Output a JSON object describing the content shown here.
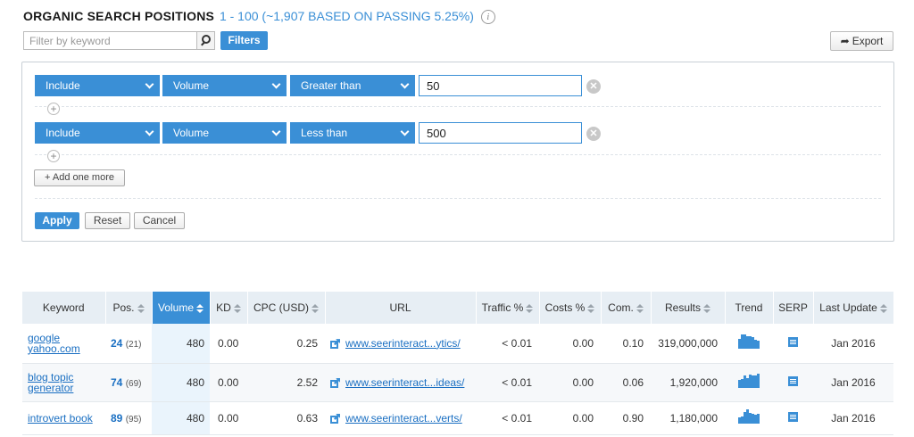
{
  "header": {
    "title": "ORGANIC SEARCH POSITIONS",
    "range": "1 - 100 (~1,907 BASED ON PASSING 5.25%)",
    "info_glyph": "i"
  },
  "toolbar": {
    "filter_placeholder": "Filter by keyword",
    "filters_label": "Filters",
    "export_label": "Export"
  },
  "filter_rules": [
    {
      "mode": "Include",
      "field": "Volume",
      "operator": "Greater than",
      "value": "50"
    },
    {
      "mode": "Include",
      "field": "Volume",
      "operator": "Less than",
      "value": "500"
    }
  ],
  "panel": {
    "add_more_label": "+ Add one more",
    "apply_label": "Apply",
    "reset_label": "Reset",
    "cancel_label": "Cancel"
  },
  "table": {
    "columns": [
      "Keyword",
      "Pos.",
      "Volume",
      "KD",
      "CPC (USD)",
      "URL",
      "Traffic %",
      "Costs %",
      "Com.",
      "Results",
      "Trend",
      "SERP",
      "Last Update"
    ],
    "active_sort": "Volume",
    "rows": [
      {
        "keyword_l1": "google",
        "keyword_l2": "yahoo.com",
        "pos": "24",
        "prev_pos": "(21)",
        "volume": "480",
        "kd": "0.00",
        "cpc": "0.25",
        "url": "www.seerinteract...ytics/",
        "traffic": "< 0.01",
        "costs": "0.00",
        "com": "0.10",
        "results": "319,000,000",
        "last_update": "Jan 2016",
        "trend": [
          0.7,
          1.0,
          1.0,
          0.9,
          0.85,
          0.8,
          0.6,
          0.55
        ]
      },
      {
        "keyword_l1": "blog topic",
        "keyword_l2": "generator",
        "pos": "74",
        "prev_pos": "(69)",
        "volume": "480",
        "kd": "0.00",
        "cpc": "2.52",
        "url": "www.seerinteract...ideas/",
        "traffic": "< 0.01",
        "costs": "0.00",
        "com": "0.06",
        "results": "1,920,000",
        "last_update": "Jan 2016",
        "trend": [
          0.55,
          0.6,
          0.85,
          0.7,
          0.95,
          0.9,
          0.9,
          1.0
        ]
      },
      {
        "keyword_l1": "introvert book",
        "keyword_l2": "",
        "pos": "89",
        "prev_pos": "(95)",
        "volume": "480",
        "kd": "0.00",
        "cpc": "0.63",
        "url": "www.seerinteract...verts/",
        "traffic": "< 0.01",
        "costs": "0.00",
        "com": "0.90",
        "results": "1,180,000",
        "last_update": "Jan 2016",
        "trend": [
          0.45,
          0.5,
          0.8,
          1.0,
          0.75,
          0.7,
          0.65,
          0.7
        ]
      }
    ]
  },
  "colors": {
    "accent": "#3a8fd6",
    "link": "#1a6fc2",
    "header_bg": "#e7eef4"
  }
}
